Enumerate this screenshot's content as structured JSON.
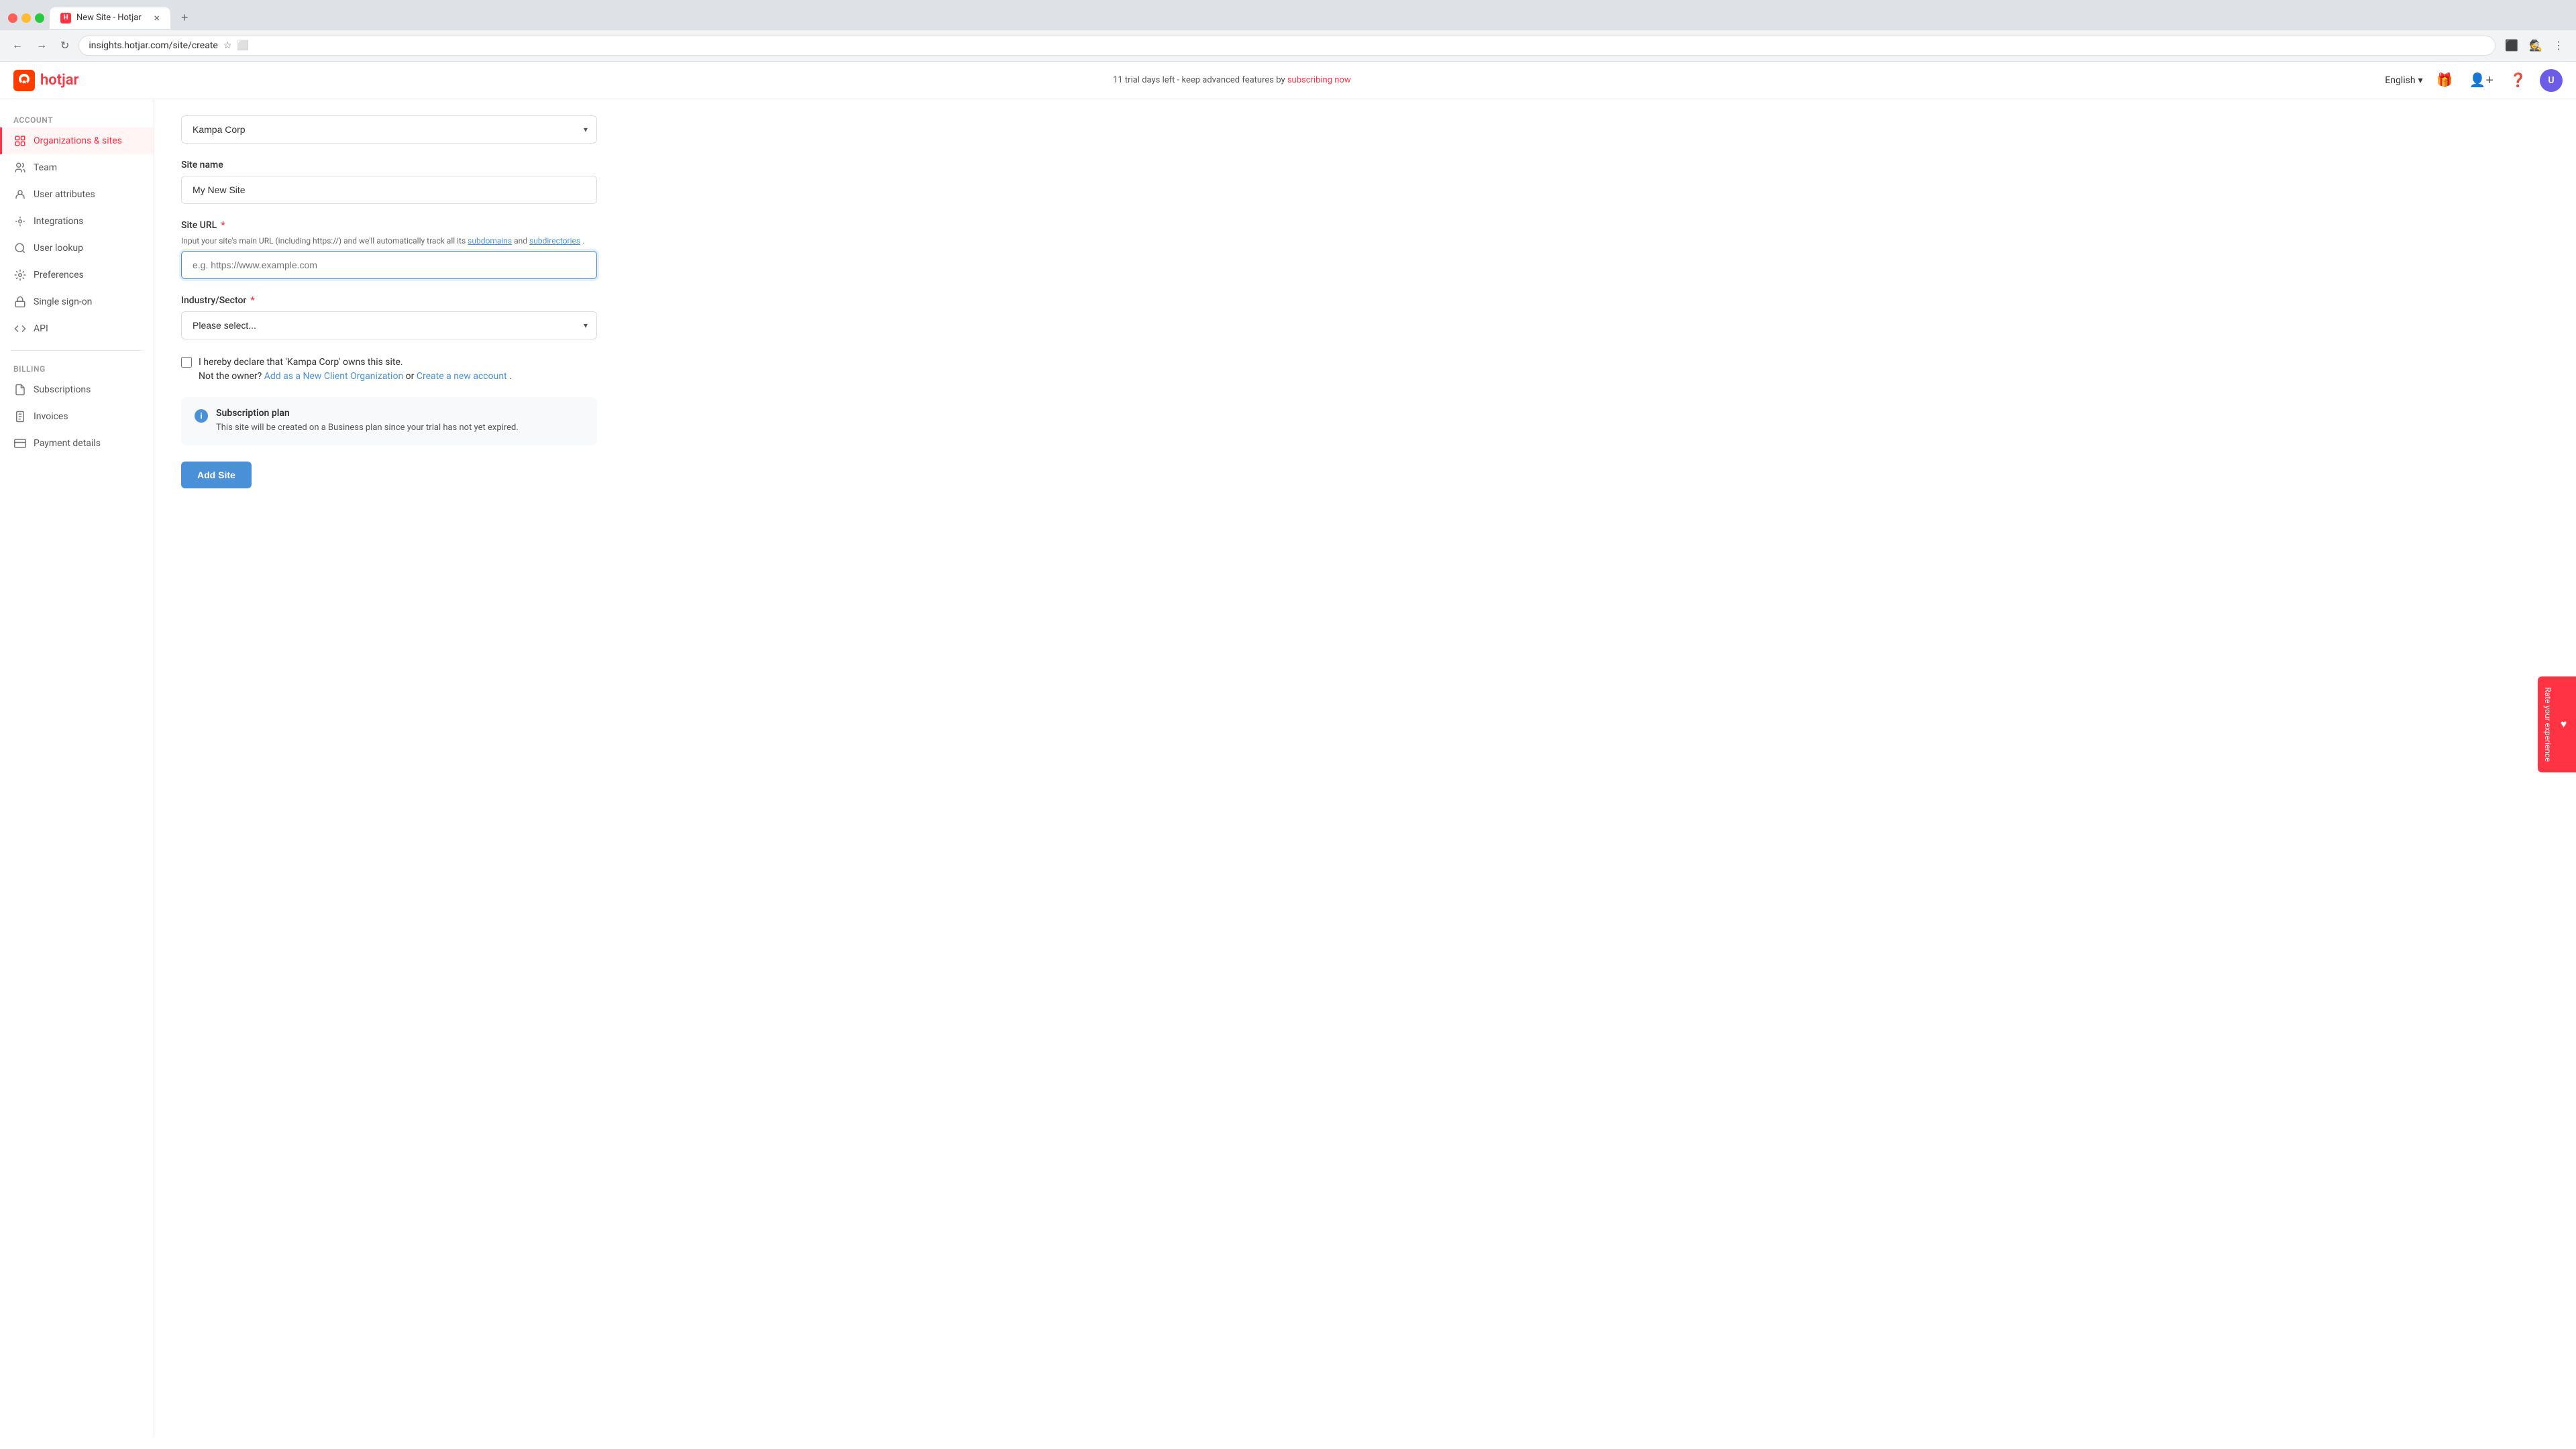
{
  "browser": {
    "tab_title": "New Site - Hotjar",
    "tab_icon": "H",
    "url": "insights.hotjar.com/site/create",
    "lang_selector": "English",
    "incognito_label": "Incognito"
  },
  "header": {
    "logo_text": "hotjar",
    "trial_text": "11 trial days left - keep advanced features by",
    "trial_link_text": "subscribing now",
    "lang": "English",
    "avatar_initials": "U"
  },
  "sidebar": {
    "account_section": "Account",
    "items": [
      {
        "id": "orgs-sites",
        "label": "Organizations & sites",
        "icon": "🏢",
        "active": true
      },
      {
        "id": "team",
        "label": "Team",
        "icon": "👤"
      },
      {
        "id": "user-attributes",
        "label": "User attributes",
        "icon": "👤"
      },
      {
        "id": "integrations",
        "label": "Integrations",
        "icon": "🔗"
      },
      {
        "id": "user-lookup",
        "label": "User lookup",
        "icon": "🔍"
      },
      {
        "id": "preferences",
        "label": "Preferences",
        "icon": "⚙️"
      },
      {
        "id": "sso",
        "label": "Single sign-on",
        "icon": "🔒"
      },
      {
        "id": "api",
        "label": "API",
        "icon": "<>"
      }
    ],
    "billing_section": "Billing",
    "billing_items": [
      {
        "id": "subscriptions",
        "label": "Subscriptions",
        "icon": "📋"
      },
      {
        "id": "invoices",
        "label": "Invoices",
        "icon": "🧾"
      },
      {
        "id": "payment-details",
        "label": "Payment details",
        "icon": "💳"
      }
    ]
  },
  "form": {
    "org_value": "Kampa Corp",
    "site_name_label": "Site name",
    "site_name_value": "My New Site",
    "site_url_label": "Site URL",
    "site_url_required": true,
    "site_url_hint": "Input your site's main URL (including https://) and we'll automatically track all its",
    "site_url_hint_subdomains": "subdomains",
    "site_url_hint_and": "and",
    "site_url_hint_subdirectories": "subdirectories",
    "site_url_hint_period": ".",
    "site_url_placeholder": "e.g. https://www.example.com",
    "industry_label": "Industry/Sector",
    "industry_required": true,
    "industry_placeholder": "Please select...",
    "checkbox_label_part1": "I hereby declare that 'Kampa Corp' owns this site.",
    "checkbox_label_part2": "Not the owner?",
    "checkbox_link1": "Add as a New Client Organization",
    "checkbox_or": "or",
    "checkbox_link2": "Create a new account",
    "subscription_title": "Subscription plan",
    "subscription_desc": "This site will be created on a Business plan since your trial has not yet expired.",
    "add_site_btn": "Add Site"
  },
  "rate_panel": {
    "label": "Rate your experience"
  }
}
